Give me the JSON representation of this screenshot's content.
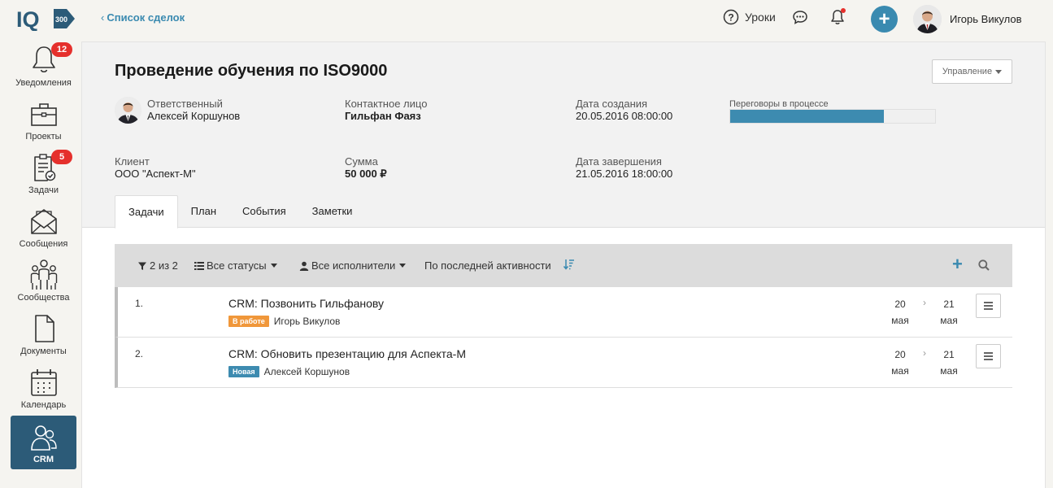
{
  "header": {
    "logo_text": "IQ",
    "logo_sub": "300",
    "back_link": "Список сделок",
    "lessons_label": "Уроки",
    "user_name": "Игорь Викулов",
    "add_label": "+"
  },
  "sidebar": {
    "items": [
      {
        "label": "Уведомления",
        "icon": "bell-icon",
        "badge": "12"
      },
      {
        "label": "Проекты",
        "icon": "briefcase-icon"
      },
      {
        "label": "Задачи",
        "icon": "tasks-icon",
        "badge": "5"
      },
      {
        "label": "Сообщения",
        "icon": "envelope-icon"
      },
      {
        "label": "Сообщества",
        "icon": "people-icon"
      },
      {
        "label": "Документы",
        "icon": "document-icon"
      },
      {
        "label": "Календарь",
        "icon": "calendar-icon"
      },
      {
        "label": "CRM",
        "icon": "crm-icon",
        "active": true
      }
    ]
  },
  "deal": {
    "title": "Проведение обучения по ISO9000",
    "manage_label": "Управление",
    "responsible_key": "Ответственный",
    "responsible_value": "Алексей Коршунов",
    "contact_key": "Контактное лицо",
    "contact_value": "Гильфан Фаяз",
    "created_key": "Дата создания",
    "created_value": "20.05.2016 08:00:00",
    "stage_label": "Переговоры в процессе",
    "stage_progress": 0.75,
    "client_key": "Клиент",
    "client_value": "ООО \"Аспект-М\"",
    "sum_key": "Сумма",
    "sum_value": "50 000 ₽",
    "finish_key": "Дата завершения",
    "finish_value": "21.05.2016 18:00:00"
  },
  "tabs": [
    "Задачи",
    "План",
    "События",
    "Заметки"
  ],
  "toolbar": {
    "filter_count": "2 из 2",
    "statuses": "Все статусы",
    "assignees": "Все исполнители",
    "sort": "По последней активности"
  },
  "tasks": [
    {
      "num": "1.",
      "title": "CRM: Позвонить Гильфанову",
      "status": "В работе",
      "status_color": "#f0973a",
      "assignee": "Игорь Викулов",
      "start_day": "20",
      "start_month": "мая",
      "end_day": "21",
      "end_month": "мая"
    },
    {
      "num": "2.",
      "title": "CRM: Обновить презентацию для Аспекта-М",
      "status": "Новая",
      "status_color": "#3d8bb0",
      "assignee": "Алексей Коршунов",
      "start_day": "20",
      "start_month": "мая",
      "end_day": "21",
      "end_month": "мая"
    }
  ],
  "colors": {
    "accent": "#3a8ab0",
    "sidebar_active": "#2c5b78",
    "badge": "#e5302c"
  }
}
